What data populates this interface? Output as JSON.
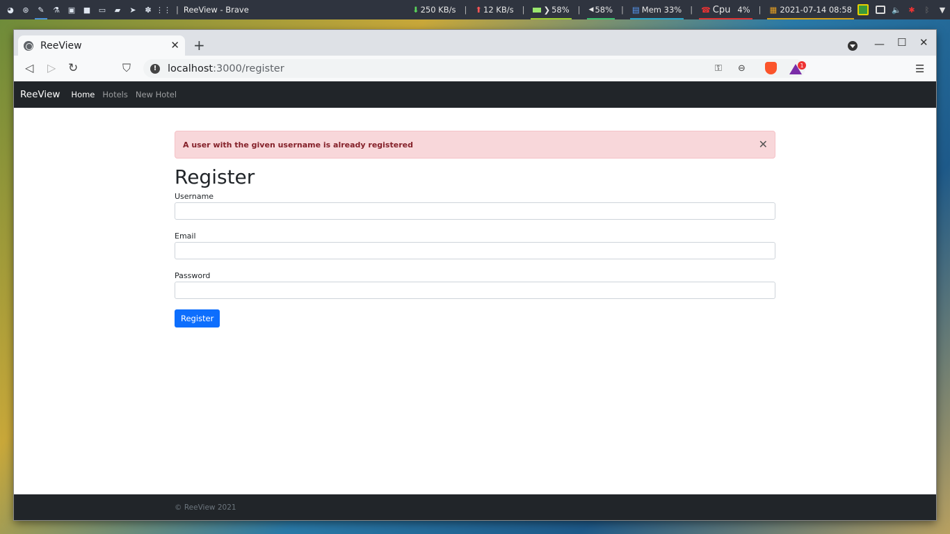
{
  "system_panel": {
    "window_title": "ReeView - Brave",
    "net_down": "250 KB/s",
    "net_up": "12 KB/s",
    "battery": "58%",
    "volume": "58%",
    "mem": "Mem 33%",
    "cpu_label": "Cpu",
    "cpu_value": "4%",
    "datetime": "2021-07-14 08:58"
  },
  "browser": {
    "tab_title": "ReeView",
    "url_host": "localhost",
    "url_path": ":3000/register",
    "rewards_count": "1"
  },
  "site": {
    "brand": "ReeView",
    "nav": [
      {
        "label": "Home",
        "active": true
      },
      {
        "label": "Hotels",
        "active": false
      },
      {
        "label": "New Hotel",
        "active": false
      }
    ],
    "alert_message": "A user with the given username is already registered",
    "page_title": "Register",
    "fields": {
      "username_label": "Username",
      "username_value": "",
      "email_label": "Email",
      "email_value": "",
      "password_label": "Password",
      "password_value": ""
    },
    "submit_label": "Register",
    "footer_text": "© ReeView 2021"
  },
  "colors": {
    "navbar_bg": "#212529",
    "alert_bg": "#f8d7da",
    "alert_text": "#842029",
    "primary": "#0d6efd"
  }
}
